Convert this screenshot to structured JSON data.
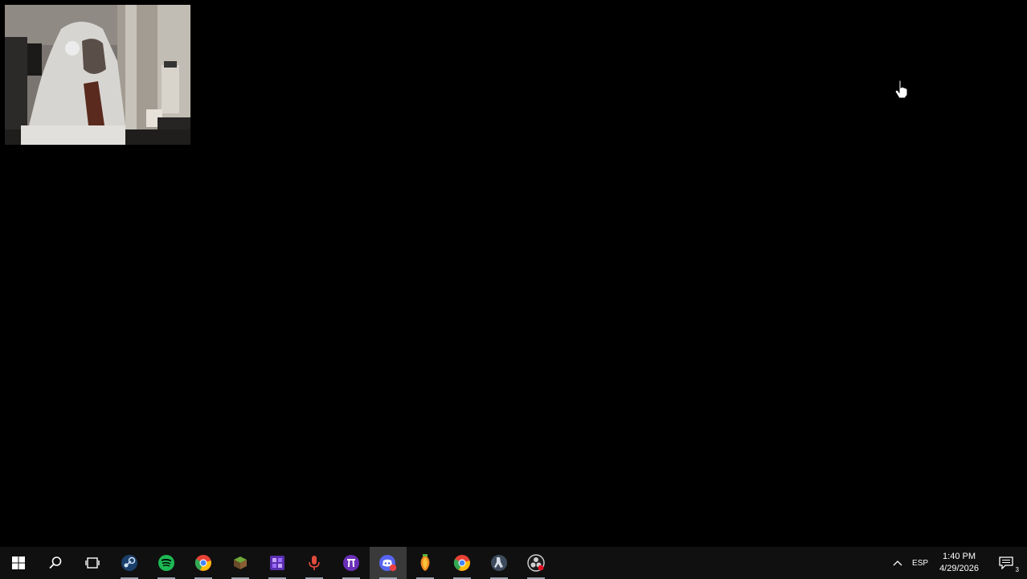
{
  "taskbar": {
    "apps": [
      {
        "name": "start-button-icon",
        "color": "#ffffff"
      },
      {
        "name": "search-icon",
        "color": "#ffffff"
      },
      {
        "name": "task-view-icon",
        "color": "#ffffff"
      },
      {
        "name": "steam-icon",
        "color": "#1b78c6"
      },
      {
        "name": "spotify-icon",
        "color": "#1db954"
      },
      {
        "name": "chrome-icon",
        "color": "#e94235"
      },
      {
        "name": "minecraft-icon",
        "color": "#5c8a2f"
      },
      {
        "name": "roblox-studio-icon",
        "color": "#7b4bd6"
      },
      {
        "name": "microphone-icon",
        "color": "#e34b3c"
      },
      {
        "name": "pi-app-icon",
        "color": "#6a2fb8"
      },
      {
        "name": "discord-icon",
        "color": "#5865f2",
        "badge": "2"
      },
      {
        "name": "fl-studio-icon",
        "color": "#f28a1e"
      },
      {
        "name": "chrome-icon",
        "color": "#e94235"
      },
      {
        "name": "counter-strike-icon",
        "color": "#8da0b8"
      },
      {
        "name": "obs-icon",
        "color": "#d0d0d0"
      }
    ]
  },
  "tray": {
    "chevron_icon": "chevron-up-icon",
    "language": "ESP",
    "time": "1:40 PM",
    "date": "4/29/2026",
    "notification_count": "3"
  }
}
